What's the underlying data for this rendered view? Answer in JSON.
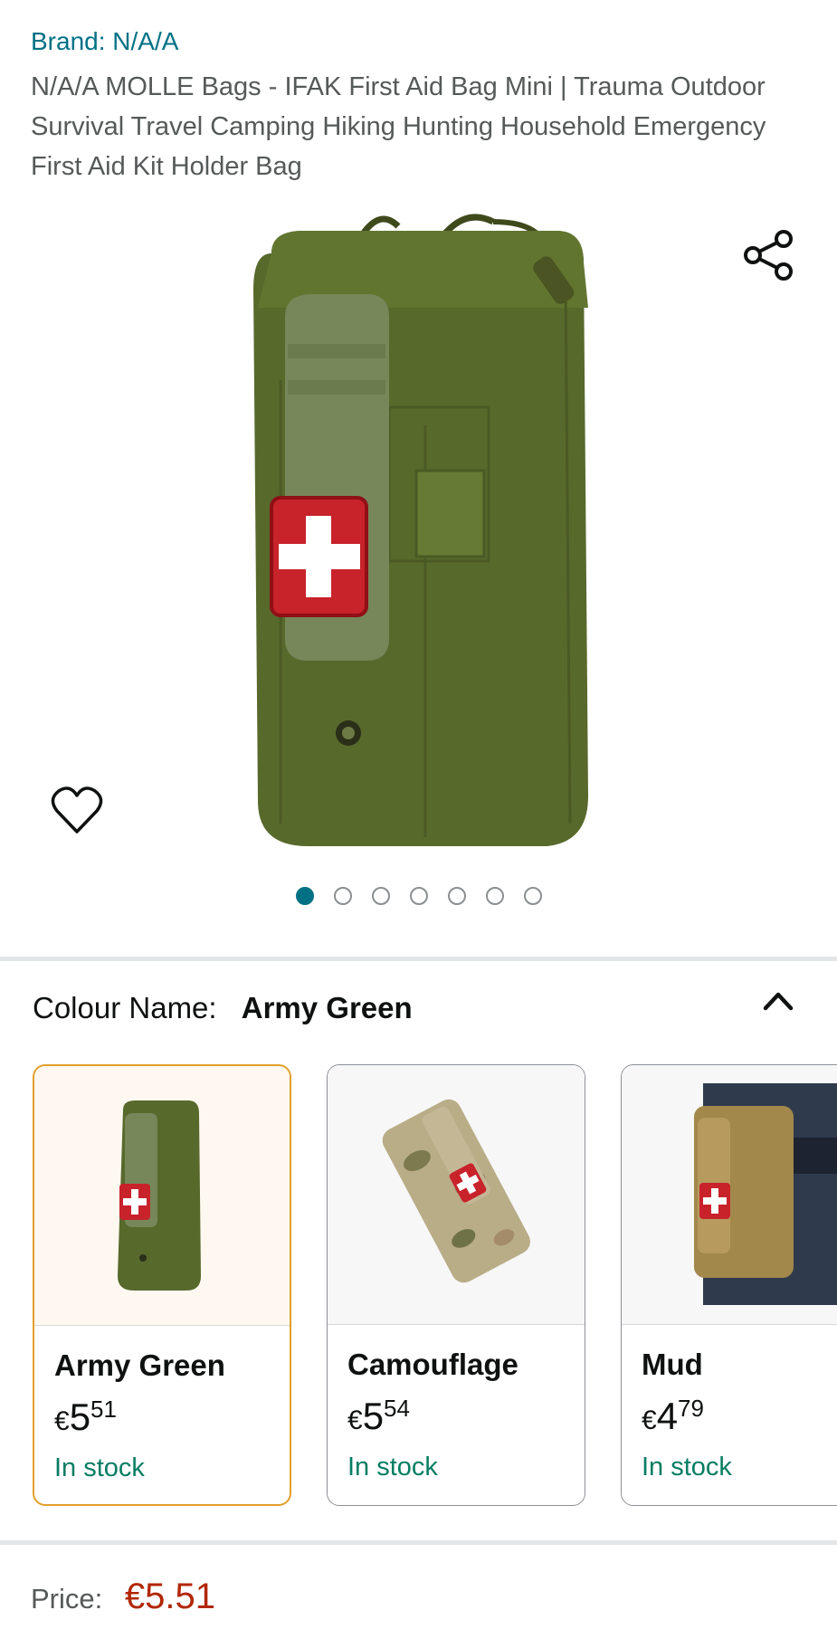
{
  "product": {
    "brand": "Brand: N/A/A",
    "title": "N/A/A MOLLE Bags - IFAK First Aid Bag Mini | Trauma Outdoor Survival Travel Camping Hiking Hunting Household Emergency First Aid Kit Holder Bag"
  },
  "gallery": {
    "image_count": 7,
    "active_index": 0
  },
  "variations": {
    "label": "Colour Name:",
    "selected": "Army Green",
    "options": [
      {
        "name": "Army Green",
        "currency": "€",
        "whole": "5",
        "fraction": "51",
        "stock": "In stock"
      },
      {
        "name": "Camouflage",
        "currency": "€",
        "whole": "5",
        "fraction": "54",
        "stock": "In stock"
      },
      {
        "name": "Mud",
        "currency": "€",
        "whole": "4",
        "fraction": "79",
        "stock": "In stock"
      }
    ]
  },
  "price": {
    "label": "Price:",
    "amount": "€5.51"
  },
  "colors": {
    "link": "#007185",
    "price": "#b12704",
    "stock": "#067d62",
    "selected_border": "#e39f2b"
  },
  "icons": [
    "share-icon",
    "heart-icon",
    "chevron-up-icon"
  ]
}
